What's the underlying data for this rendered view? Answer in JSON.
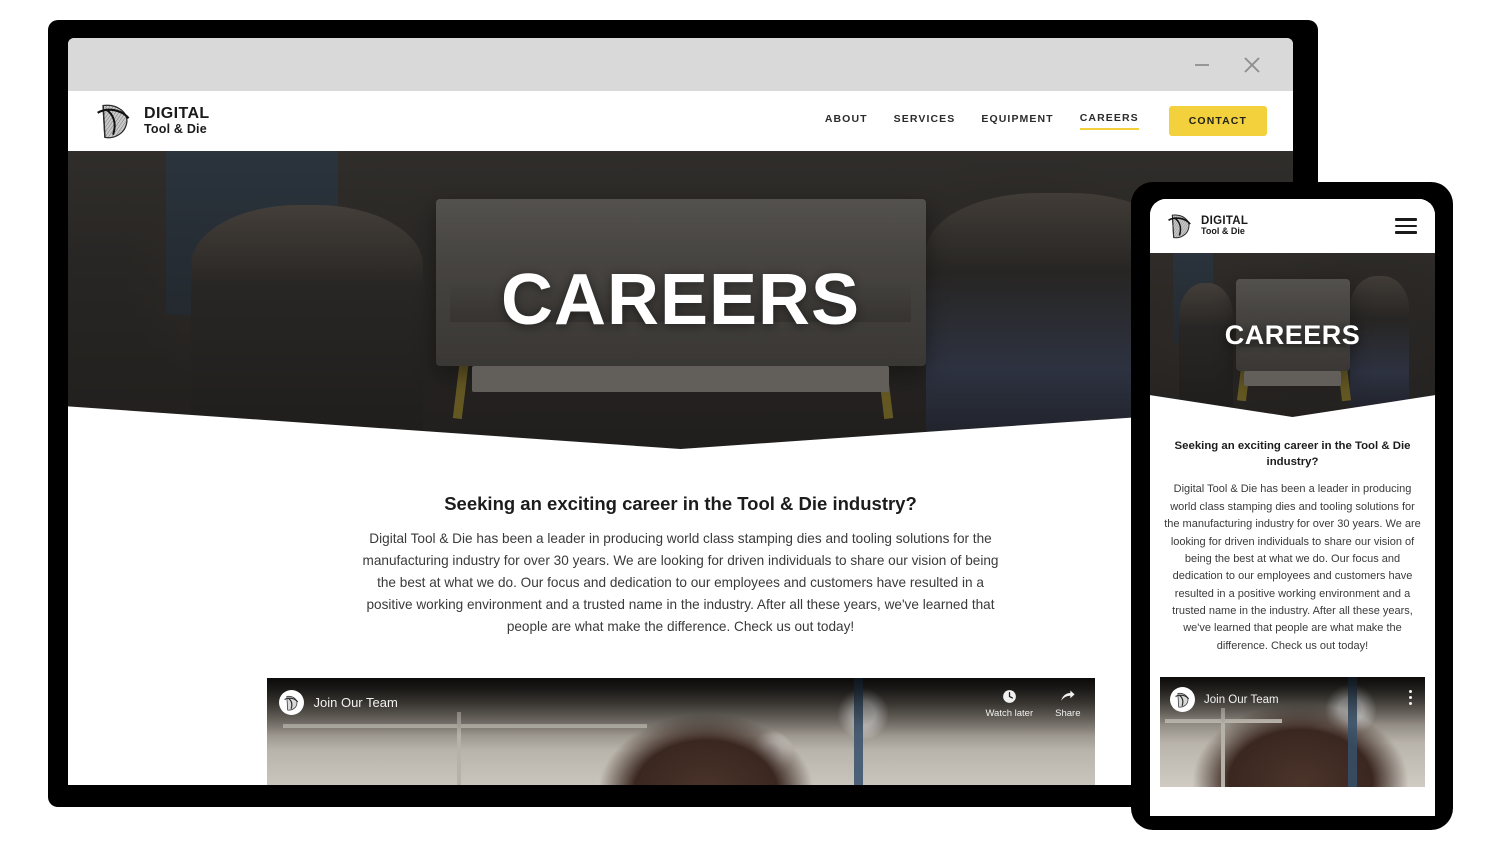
{
  "window": {
    "minimize_label": "Minimize",
    "close_label": "Close"
  },
  "brand": {
    "line1": "DIGITAL",
    "line2": "Tool & Die",
    "logo_icon": "digital-tool-and-die-logo"
  },
  "nav": {
    "items": [
      {
        "label": "ABOUT",
        "active": false
      },
      {
        "label": "SERVICES",
        "active": false
      },
      {
        "label": "EQUIPMENT",
        "active": false
      },
      {
        "label": "CAREERS",
        "active": true
      }
    ],
    "cta_label": "CONTACT",
    "menu_icon": "hamburger-menu-icon"
  },
  "hero": {
    "title": "CAREERS"
  },
  "content": {
    "heading": "Seeking an exciting career in the Tool & Die industry?",
    "body": "Digital Tool & Die has been a leader in producing world class stamping dies and tooling solutions for the manufacturing industry for over 30 years. We are looking for driven individuals to share our vision of being the best at what we do. Our focus and dedication to our employees and customers have resulted in a positive working environment and a trusted name in the industry. After all these years, we've learned that people are what make the difference. Check us out today!"
  },
  "video": {
    "title": "Join Our Team",
    "avatar_icon": "channel-avatar-icon",
    "watch_later_label": "Watch later",
    "watch_later_icon": "clock-icon",
    "share_label": "Share",
    "share_icon": "share-arrow-icon",
    "more_icon": "kebab-menu-icon"
  },
  "colors": {
    "accent_yellow": "#f2d13c",
    "underline_yellow": "#f2cf3b",
    "bezel_black": "#000000",
    "titlebar_gray": "#d9d9d9",
    "text_dark": "#1c1c1c"
  }
}
